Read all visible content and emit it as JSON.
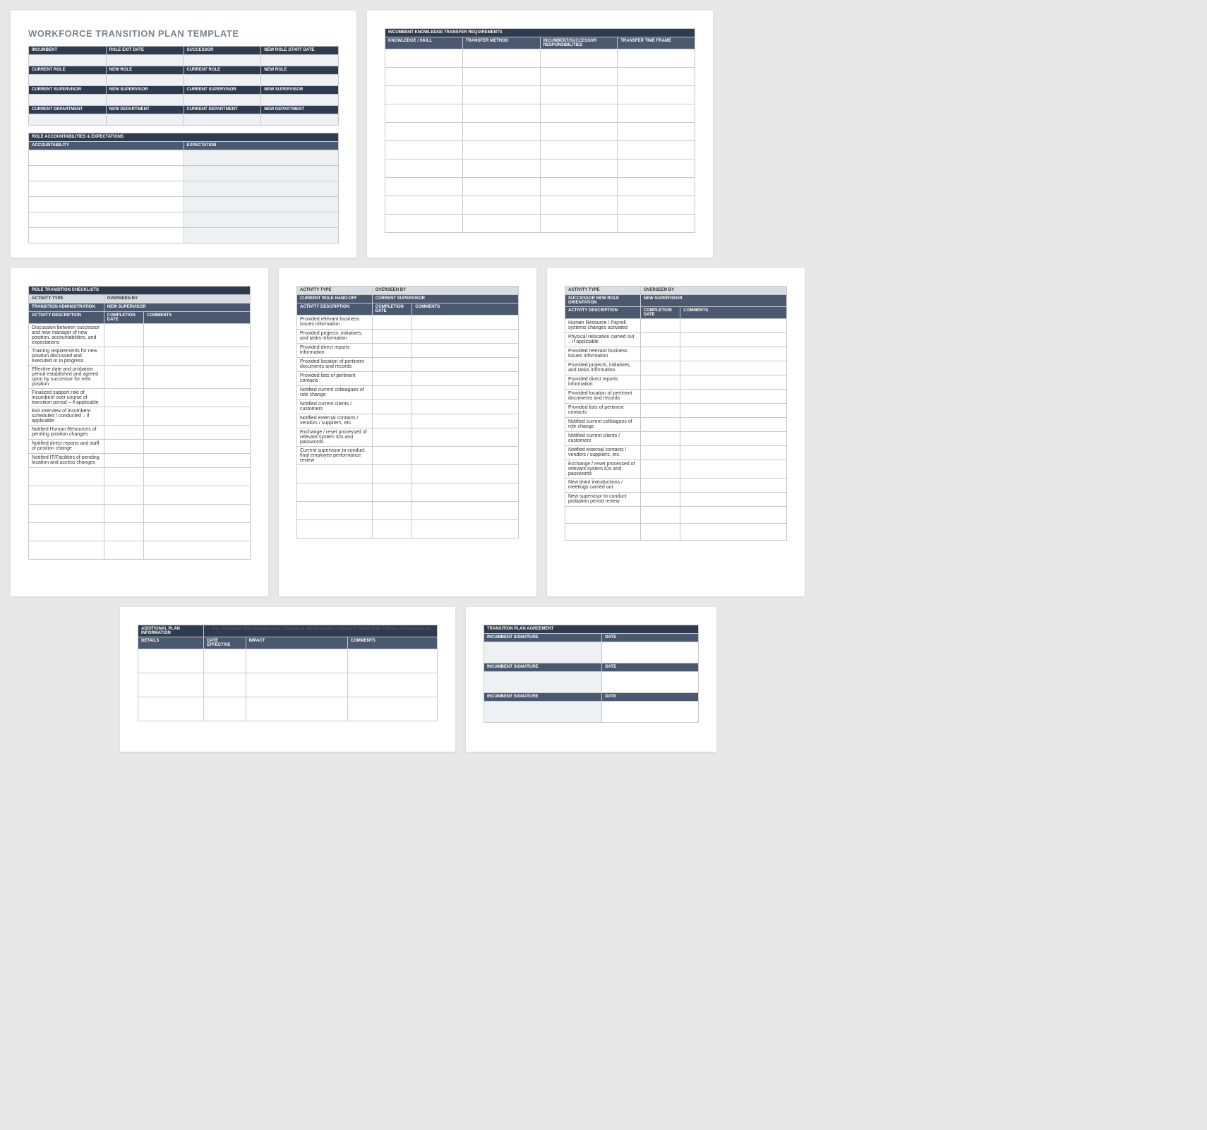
{
  "title": "WORKFORCE TRANSITION PLAN TEMPLATE",
  "info": {
    "r1": [
      "INCUMBENT",
      "ROLE EXIT DATE",
      "SUCCESSOR",
      "NEW ROLE START DATE"
    ],
    "r2": [
      "CURRENT ROLE",
      "NEW ROLE",
      "CURRENT ROLE",
      "NEW ROLE"
    ],
    "r3": [
      "CURRENT SUPERVISOR",
      "NEW SUPERVISOR",
      "CURRENT SUPERVISOR",
      "NEW SUPERVISOR"
    ],
    "r4": [
      "CURRENT DEPARTMENT",
      "NEW DEPARTMENT",
      "CURRENT DEPARTMENT",
      "NEW DEPARTMENT"
    ]
  },
  "role_acc": {
    "title": "ROLE ACCOUNTABILITIES & EXPECTATIONS",
    "cols": [
      "ACCOUNTABILITY",
      "EXPECTATION"
    ]
  },
  "ktr": {
    "title": "INCUMBENT KNOWLEDGE TRANSFER REQUIREMENTS",
    "cols": [
      "KNOWLEDGE / SKILL",
      "TRANSFER METHOD",
      "INCUMBENT/SUCCESSOR RESPONSIBILITIES",
      "TRANSFER TIME FRAME"
    ]
  },
  "chk": {
    "title": "ROLE TRANSITION CHECKLISTS",
    "h1": [
      "ACTIVITY TYPE",
      "OVERSEEN BY"
    ],
    "h2a": [
      "TRANSITION ADMINISTRATION",
      "NEW SUPERVISOR"
    ],
    "h2b": [
      "CURRENT ROLE HAND-OFF",
      "CURRENT SUPERVISOR"
    ],
    "h2c": [
      "SUCCESSOR NEW ROLE ORIENTATION",
      "NEW SUPERVISOR"
    ],
    "cols": [
      "ACTIVITY DESCRIPTION",
      "COMPLETION DATE",
      "COMMENTS"
    ],
    "a": [
      "Discussion between successor and new manager of new position, accountabilities, and expectations",
      "Training requirements for new position discussed and executed or in progress",
      "Effective date and probation period established and agreed upon by successor for new position",
      "Finalized support role of incumbent over course of transition period – if applicable",
      "Exit interview of incumbent scheduled / conducted – if applicable",
      "Notified Human Resources of pending position changes",
      "Notified direct reports and staff of position change",
      "Notified IT/Facilities of pending location and access changes"
    ],
    "b": [
      "Provided relevant business issues information",
      "Provided projects, initiatives, and tasks information",
      "Provided direct reports information",
      "Provided location of pertinent documents and records",
      "Provided lists of pertinent contacts",
      "Notified current colleagues of role change",
      "Notified current clients / customers",
      "Notified external contacts / vendors / suppliers, etc.",
      "Exchange / reset processed of relevant system IDs and passwords",
      "Current supervisor to conduct final employee performance review"
    ],
    "c": [
      "Human Resource / Payroll systems changes activated",
      "Physical relocation carried out – if applicable",
      "Provided relevant business issues information",
      "Provided projects, initiatives, and tasks information",
      "Provided direct reports information",
      "Provided location of pertinent documents and records",
      "Provided lists of pertinent contacts",
      "Notified current colleagues of role change",
      "Notified current clients / customers",
      "Notified external contacts / vendors / suppliers, etc.",
      "Exchange / reset processed of relevant system IDs and passwords",
      "New team introductions / meetings carried out",
      "New supervisor to conduct probation period review"
    ]
  },
  "addl": {
    "title": "ADDITIONAL PLAN INFORMATION",
    "note": "e.g., Alternative Work Arrangements, Changes to Job Description, Impacts to Fellow Staff, Policies, or Processes, etc.",
    "cols": [
      "DETAILS",
      "DATE EFFECTIVE",
      "IMPACT",
      "COMMENTS"
    ]
  },
  "agree": {
    "title": "TRANSITION PLAN AGREEMENT",
    "sig": "INCUMBENT SIGNATURE",
    "date": "DATE"
  }
}
